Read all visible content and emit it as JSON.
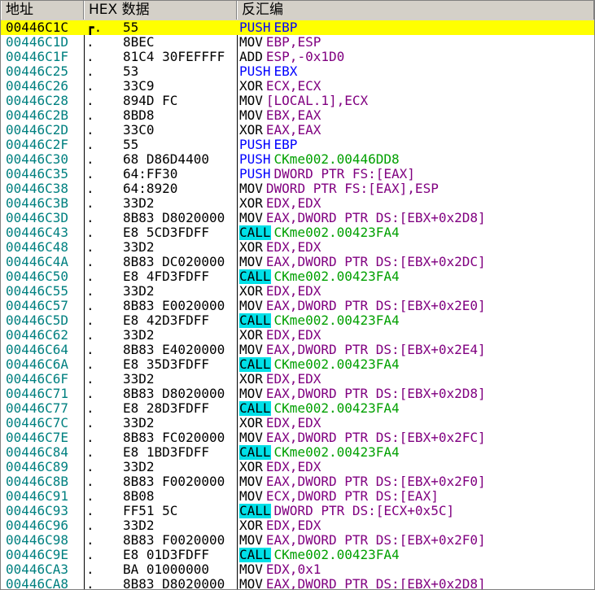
{
  "headers": {
    "address": "地址",
    "hex": "HEX 数据",
    "disasm": "反汇编"
  },
  "rows": [
    {
      "addr": "00446C1C",
      "mark": "┏.",
      "hex": "55",
      "mn": "PUSH",
      "op": "EBP",
      "type": "push",
      "sel": true
    },
    {
      "addr": "00446C1D",
      "mark": ".",
      "hex": "8BEC",
      "mn": "MOV",
      "op": "EBP,ESP",
      "type": "mov"
    },
    {
      "addr": "00446C1F",
      "mark": ".",
      "hex": "81C4 30FEFFFF",
      "mn": "ADD",
      "op": "ESP,-0x1D0",
      "type": "mov"
    },
    {
      "addr": "00446C25",
      "mark": ".",
      "hex": "53",
      "mn": "PUSH",
      "op": "EBX",
      "type": "push"
    },
    {
      "addr": "00446C26",
      "mark": ".",
      "hex": "33C9",
      "mn": "XOR",
      "op": "ECX,ECX",
      "type": "mov"
    },
    {
      "addr": "00446C28",
      "mark": ".",
      "hex": "894D FC",
      "mn": "MOV",
      "op": "[LOCAL.1],ECX",
      "type": "mov"
    },
    {
      "addr": "00446C2B",
      "mark": ".",
      "hex": "8BD8",
      "mn": "MOV",
      "op": "EBX,EAX",
      "type": "mov"
    },
    {
      "addr": "00446C2D",
      "mark": ".",
      "hex": "33C0",
      "mn": "XOR",
      "op": "EAX,EAX",
      "type": "mov"
    },
    {
      "addr": "00446C2F",
      "mark": ".",
      "hex": "55",
      "mn": "PUSH",
      "op": "EBP",
      "type": "push"
    },
    {
      "addr": "00446C30",
      "mark": ".",
      "hex": "68 D86D4400",
      "mn": "PUSH",
      "op": "CKme002.00446DD8",
      "type": "pushaddr"
    },
    {
      "addr": "00446C35",
      "mark": ".",
      "hex": "64:FF30",
      "mn": "PUSH",
      "op": "DWORD PTR FS:[EAX]",
      "type": "pushmem"
    },
    {
      "addr": "00446C38",
      "mark": ".",
      "hex": "64:8920",
      "mn": "MOV",
      "op": "DWORD PTR FS:[EAX],ESP",
      "type": "mov"
    },
    {
      "addr": "00446C3B",
      "mark": ".",
      "hex": "33D2",
      "mn": "XOR",
      "op": "EDX,EDX",
      "type": "mov"
    },
    {
      "addr": "00446C3D",
      "mark": ".",
      "hex": "8B83 D8020000",
      "mn": "MOV",
      "op": "EAX,DWORD PTR DS:[EBX+0x2D8]",
      "type": "mov"
    },
    {
      "addr": "00446C43",
      "mark": ".",
      "hex": "E8 5CD3FDFF",
      "mn": "CALL",
      "op": "CKme002.00423FA4",
      "type": "call"
    },
    {
      "addr": "00446C48",
      "mark": ".",
      "hex": "33D2",
      "mn": "XOR",
      "op": "EDX,EDX",
      "type": "mov"
    },
    {
      "addr": "00446C4A",
      "mark": ".",
      "hex": "8B83 DC020000",
      "mn": "MOV",
      "op": "EAX,DWORD PTR DS:[EBX+0x2DC]",
      "type": "mov"
    },
    {
      "addr": "00446C50",
      "mark": ".",
      "hex": "E8 4FD3FDFF",
      "mn": "CALL",
      "op": "CKme002.00423FA4",
      "type": "call"
    },
    {
      "addr": "00446C55",
      "mark": ".",
      "hex": "33D2",
      "mn": "XOR",
      "op": "EDX,EDX",
      "type": "mov"
    },
    {
      "addr": "00446C57",
      "mark": ".",
      "hex": "8B83 E0020000",
      "mn": "MOV",
      "op": "EAX,DWORD PTR DS:[EBX+0x2E0]",
      "type": "mov"
    },
    {
      "addr": "00446C5D",
      "mark": ".",
      "hex": "E8 42D3FDFF",
      "mn": "CALL",
      "op": "CKme002.00423FA4",
      "type": "call"
    },
    {
      "addr": "00446C62",
      "mark": ".",
      "hex": "33D2",
      "mn": "XOR",
      "op": "EDX,EDX",
      "type": "mov"
    },
    {
      "addr": "00446C64",
      "mark": ".",
      "hex": "8B83 E4020000",
      "mn": "MOV",
      "op": "EAX,DWORD PTR DS:[EBX+0x2E4]",
      "type": "mov"
    },
    {
      "addr": "00446C6A",
      "mark": ".",
      "hex": "E8 35D3FDFF",
      "mn": "CALL",
      "op": "CKme002.00423FA4",
      "type": "call"
    },
    {
      "addr": "00446C6F",
      "mark": ".",
      "hex": "33D2",
      "mn": "XOR",
      "op": "EDX,EDX",
      "type": "mov"
    },
    {
      "addr": "00446C71",
      "mark": ".",
      "hex": "8B83 D8020000",
      "mn": "MOV",
      "op": "EAX,DWORD PTR DS:[EBX+0x2D8]",
      "type": "mov"
    },
    {
      "addr": "00446C77",
      "mark": ".",
      "hex": "E8 28D3FDFF",
      "mn": "CALL",
      "op": "CKme002.00423FA4",
      "type": "call"
    },
    {
      "addr": "00446C7C",
      "mark": ".",
      "hex": "33D2",
      "mn": "XOR",
      "op": "EDX,EDX",
      "type": "mov"
    },
    {
      "addr": "00446C7E",
      "mark": ".",
      "hex": "8B83 FC020000",
      "mn": "MOV",
      "op": "EAX,DWORD PTR DS:[EBX+0x2FC]",
      "type": "mov"
    },
    {
      "addr": "00446C84",
      "mark": ".",
      "hex": "E8 1BD3FDFF",
      "mn": "CALL",
      "op": "CKme002.00423FA4",
      "type": "call"
    },
    {
      "addr": "00446C89",
      "mark": ".",
      "hex": "33D2",
      "mn": "XOR",
      "op": "EDX,EDX",
      "type": "mov"
    },
    {
      "addr": "00446C8B",
      "mark": ".",
      "hex": "8B83 F0020000",
      "mn": "MOV",
      "op": "EAX,DWORD PTR DS:[EBX+0x2F0]",
      "type": "mov"
    },
    {
      "addr": "00446C91",
      "mark": ".",
      "hex": "8B08",
      "mn": "MOV",
      "op": "ECX,DWORD PTR DS:[EAX]",
      "type": "mov"
    },
    {
      "addr": "00446C93",
      "mark": ".",
      "hex": "FF51 5C",
      "mn": "CALL",
      "op": "DWORD PTR DS:[ECX+0x5C]",
      "type": "callmem"
    },
    {
      "addr": "00446C96",
      "mark": ".",
      "hex": "33D2",
      "mn": "XOR",
      "op": "EDX,EDX",
      "type": "mov"
    },
    {
      "addr": "00446C98",
      "mark": ".",
      "hex": "8B83 F0020000",
      "mn": "MOV",
      "op": "EAX,DWORD PTR DS:[EBX+0x2F0]",
      "type": "mov"
    },
    {
      "addr": "00446C9E",
      "mark": ".",
      "hex": "E8 01D3FDFF",
      "mn": "CALL",
      "op": "CKme002.00423FA4",
      "type": "call"
    },
    {
      "addr": "00446CA3",
      "mark": ".",
      "hex": "BA 01000000",
      "mn": "MOV",
      "op": "EDX,0x1",
      "type": "mov"
    },
    {
      "addr": "00446CA8",
      "mark": ".",
      "hex": "8B83 D8020000",
      "mn": "MOV",
      "op": "EAX,DWORD PTR DS:[EBX+0x2D8]",
      "type": "mov"
    }
  ],
  "colors": {
    "address": "#008080",
    "selection": "#ffff00",
    "call_highlight": "#00e0e8",
    "push": "#0000ff",
    "operand": "#800080",
    "label": "#00a000"
  }
}
